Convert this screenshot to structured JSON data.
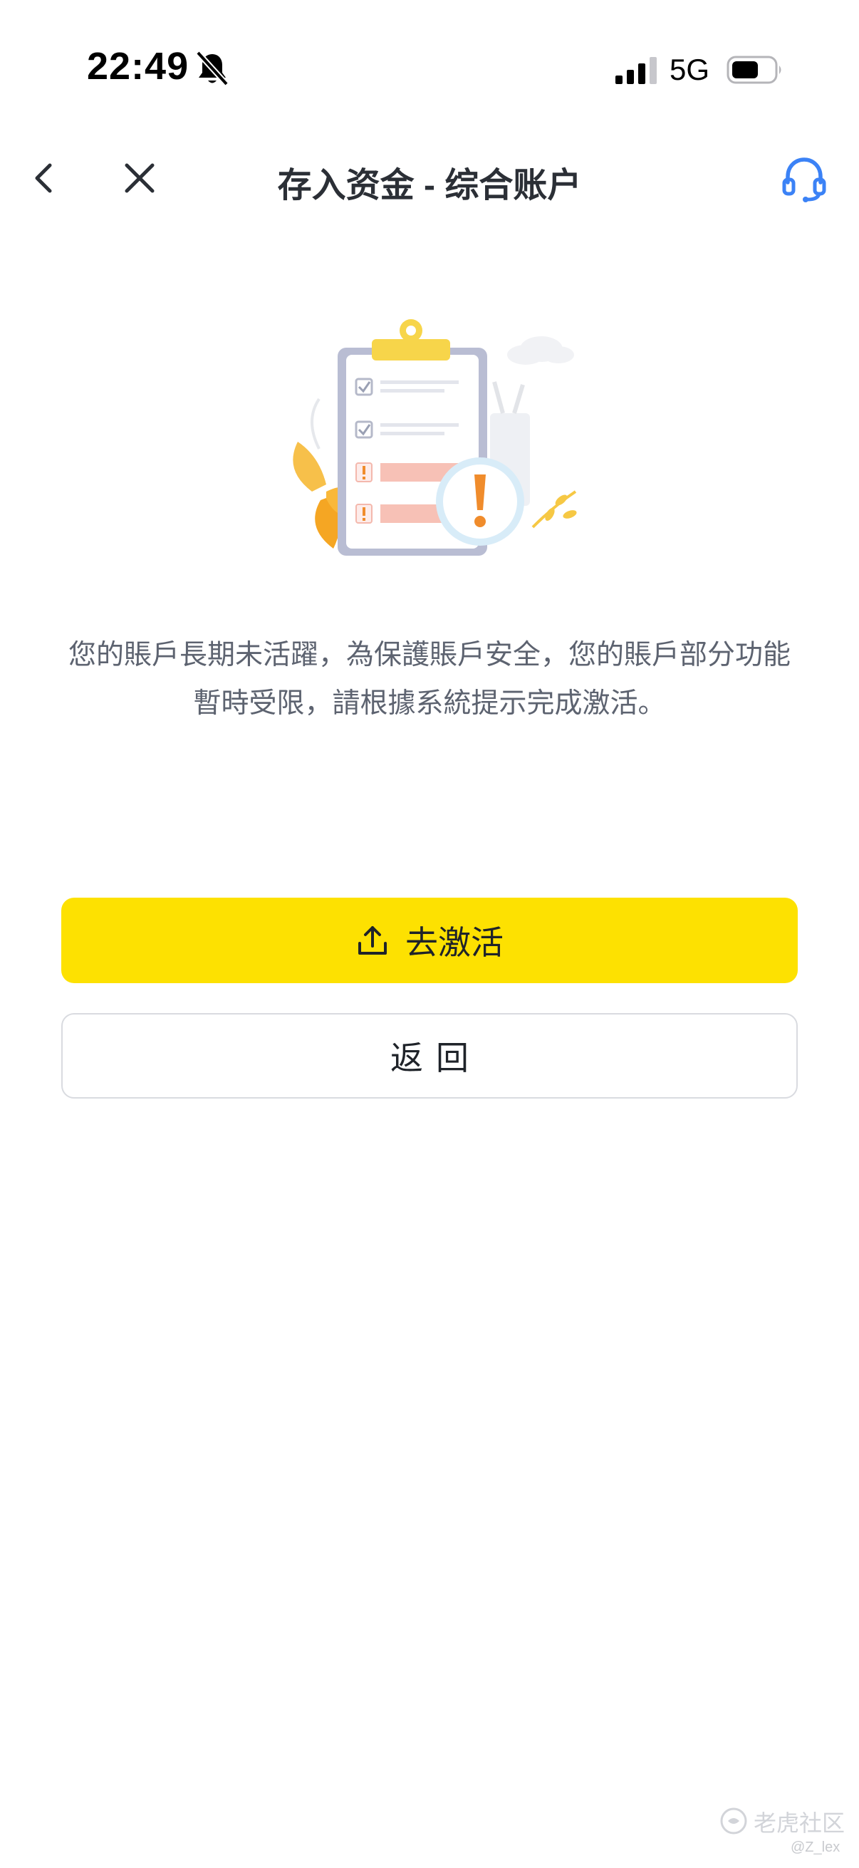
{
  "status_bar": {
    "time": "22:49",
    "network": "5G"
  },
  "nav": {
    "title": "存入资金 - 综合账户"
  },
  "message": {
    "line1": "您的賬戶長期未活躍，為保護賬戶安全，您的賬戶部分功能",
    "line2": "暫時受限，請根據系統提示完成激活。"
  },
  "buttons": {
    "activate_label": "去激活",
    "back_label": "返回"
  },
  "watermark": {
    "brand": "老虎社区",
    "user": "@Z_lex"
  },
  "colors": {
    "primary": "#fde101",
    "accent": "#3b82f6",
    "warning": "#f08c2c"
  },
  "icons": [
    "muted-bell-icon",
    "signal-icon",
    "battery-icon",
    "back-arrow-icon",
    "close-icon",
    "headset-icon",
    "upload-icon"
  ]
}
